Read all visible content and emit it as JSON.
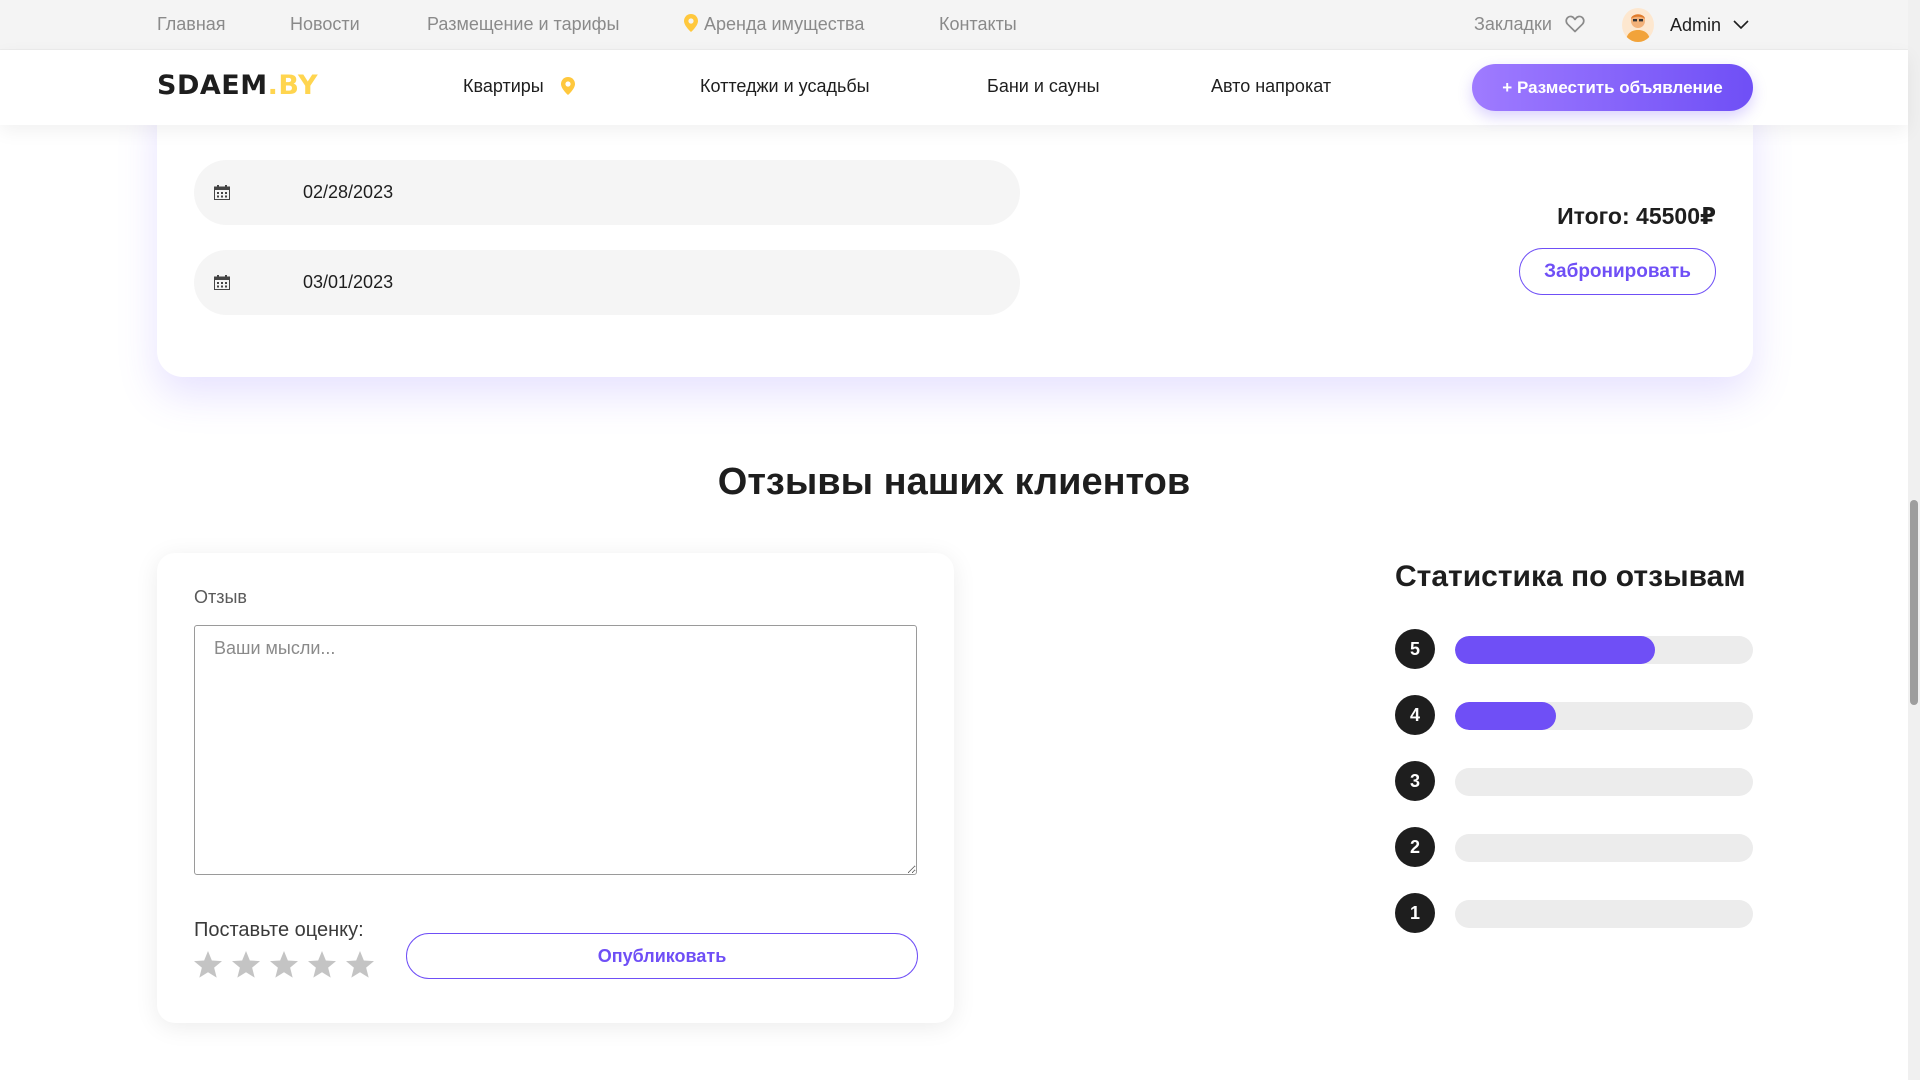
{
  "topbar": {
    "links": [
      "Главная",
      "Новости",
      "Размещение и тарифы",
      "Аренда имущества",
      "Контакты"
    ],
    "bookmarks_label": "Закладки",
    "user_name": "Admin"
  },
  "mainnav": {
    "logo_main": "SDAEM",
    "logo_suffix": ".BY",
    "items": [
      "Квартиры",
      "Коттеджи и усадьбы",
      "Бани и сауны",
      "Авто напрокат"
    ],
    "cta_label": "+ Разместить объявление"
  },
  "booking": {
    "check_in": "02/28/2023",
    "check_out": "03/01/2023",
    "total_label": "Итого: 45500₽",
    "book_label": "Забронировать"
  },
  "reviews": {
    "title": "Отзывы наших клиентов",
    "field_label": "Отзыв",
    "placeholder": "Ваши мысли...",
    "rate_label": "Поставьте оценку:",
    "rating_value": 0,
    "rating_max": 5,
    "publish_label": "Опубликовать"
  },
  "stats": {
    "title": "Статистика по отзывам",
    "rows": [
      {
        "rating": "5",
        "fraction": 0.67
      },
      {
        "rating": "4",
        "fraction": 0.34
      },
      {
        "rating": "3",
        "fraction": 0
      },
      {
        "rating": "2",
        "fraction": 0
      },
      {
        "rating": "1",
        "fraction": 0
      }
    ]
  },
  "colors": {
    "accent": "#6f4ff6",
    "accent_light": "#9f7bff",
    "logo_accent": "#ffd54f",
    "pin": "#ffc83d",
    "dark": "#1e1e1e"
  },
  "icons": {
    "pin": "location-pin-icon",
    "heart": "heart-icon",
    "chevron": "chevron-down-icon",
    "calendar": "calendar-icon",
    "star": "star-icon"
  }
}
